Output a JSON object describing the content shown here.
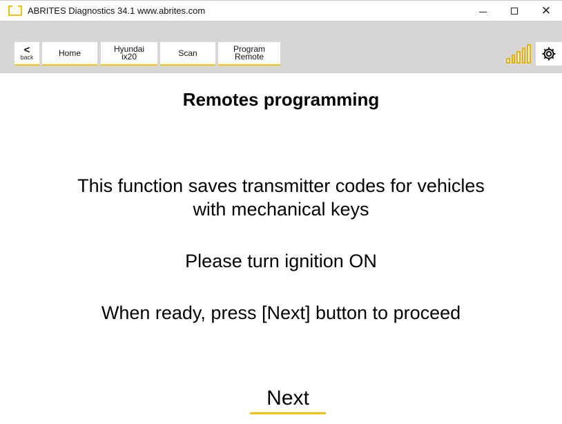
{
  "window": {
    "title": "ABRITES Diagnostics 34.1   www.abrites.com",
    "minimize_icon": "minimize-icon",
    "maximize_icon": "maximize-icon",
    "close_icon": "close-icon",
    "close_glyph": "✕"
  },
  "toolbar": {
    "back_glyph": "<",
    "back_label": "back",
    "home_label": "Home",
    "vehicle_label": "Hyundai\nix20",
    "scan_label": "Scan",
    "program_label": "Program\nRemote",
    "signal_icon": "signal-strength-icon",
    "settings_icon": "gear-icon"
  },
  "content": {
    "heading": "Remotes programming",
    "message_1": "This function saves transmitter codes for vehicles\nwith mechanical keys",
    "message_2": "Please turn ignition ON",
    "message_3": "When ready, press [Next] button to proceed",
    "next_label": "Next"
  },
  "colors": {
    "accent": "#f2c200",
    "toolbar_bg": "#d6d6d6"
  }
}
